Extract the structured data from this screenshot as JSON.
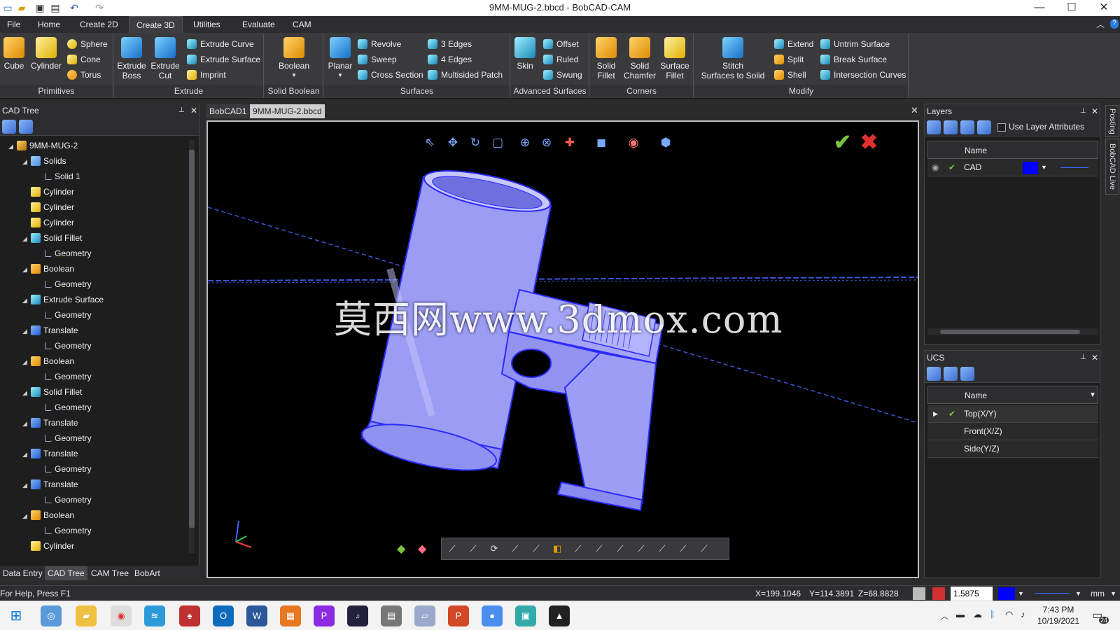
{
  "window": {
    "title": "9MM-MUG-2.bbcd - BobCAD-CAM",
    "minimize": "—",
    "maximize": "☐",
    "close": "✕"
  },
  "quick_access": [
    "new-doc-icon",
    "open-folder-icon",
    "save-icon",
    "save-all-icon",
    "undo-icon",
    "redo-icon"
  ],
  "menus": [
    "File",
    "Home",
    "Create 2D",
    "Create 3D",
    "Utilities",
    "Evaluate",
    "CAM"
  ],
  "active_menu": "Create 3D",
  "ribbon": {
    "primitives": {
      "label": "Primitives",
      "cube": "Cube",
      "cylinder": "Cylinder",
      "sphere": "Sphere",
      "cone": "Cone",
      "torus": "Torus"
    },
    "extrude": {
      "label": "Extrude",
      "boss": "Extrude\nBoss",
      "cut": "Extrude\nCut",
      "curve": "Extrude Curve",
      "surface": "Extrude Surface",
      "imprint": "Imprint"
    },
    "solid_boolean": {
      "label": "Solid Boolean",
      "boolean": "Boolean"
    },
    "surfaces": {
      "label": "Surfaces",
      "planar": "Planar",
      "revolve": "Revolve",
      "sweep": "Sweep",
      "cross_section": "Cross Section",
      "edges3": "3 Edges",
      "edges4": "4 Edges",
      "multisided": "Multisided Patch"
    },
    "advanced": {
      "label": "Advanced Surfaces",
      "skin": "Skin",
      "offset": "Offset",
      "ruled": "Ruled",
      "swung": "Swung"
    },
    "corners": {
      "label": "Corners",
      "solid_fillet": "Solid\nFillet",
      "solid_chamfer": "Solid\nChamfer",
      "surface_fillet": "Surface\nFillet"
    },
    "modify": {
      "label": "Modify",
      "stitch": "Stitch\nSurfaces to Solid",
      "extend": "Extend",
      "split": "Split",
      "shell": "Shell",
      "untrim": "Untrim Surface",
      "break": "Break Surface",
      "intersection": "Intersection Curves"
    }
  },
  "cad_tree": {
    "title": "CAD Tree",
    "items": [
      {
        "label": "9MM-MUG-2",
        "level": 0,
        "expand": "◢",
        "icon": "gear"
      },
      {
        "label": "Solids",
        "level": 1,
        "expand": "◢",
        "icon": "folder"
      },
      {
        "label": "Solid 1",
        "level": 2,
        "expand": "",
        "icon": "solid"
      },
      {
        "label": "Cylinder",
        "level": 1,
        "expand": "",
        "icon": "yellow"
      },
      {
        "label": "Cylinder",
        "level": 1,
        "expand": "",
        "icon": "yellow"
      },
      {
        "label": "Cylinder",
        "level": 1,
        "expand": "",
        "icon": "yellow"
      },
      {
        "label": "Solid Fillet",
        "level": 1,
        "expand": "◢",
        "icon": "teal"
      },
      {
        "label": "Geometry",
        "level": 2,
        "expand": "",
        "icon": "geo"
      },
      {
        "label": "Boolean",
        "level": 1,
        "expand": "◢",
        "icon": "orange"
      },
      {
        "label": "Geometry",
        "level": 2,
        "expand": "",
        "icon": "geo"
      },
      {
        "label": "Extrude Surface",
        "level": 1,
        "expand": "◢",
        "icon": "teal"
      },
      {
        "label": "Geometry",
        "level": 2,
        "expand": "",
        "icon": "geo"
      },
      {
        "label": "Translate",
        "level": 1,
        "expand": "◢",
        "icon": "blue"
      },
      {
        "label": "Geometry",
        "level": 2,
        "expand": "",
        "icon": "geo"
      },
      {
        "label": "Boolean",
        "level": 1,
        "expand": "◢",
        "icon": "orange"
      },
      {
        "label": "Geometry",
        "level": 2,
        "expand": "",
        "icon": "geo"
      },
      {
        "label": "Solid Fillet",
        "level": 1,
        "expand": "◢",
        "icon": "teal"
      },
      {
        "label": "Geometry",
        "level": 2,
        "expand": "",
        "icon": "geo"
      },
      {
        "label": "Translate",
        "level": 1,
        "expand": "◢",
        "icon": "blue"
      },
      {
        "label": "Geometry",
        "level": 2,
        "expand": "",
        "icon": "geo"
      },
      {
        "label": "Translate",
        "level": 1,
        "expand": "◢",
        "icon": "blue"
      },
      {
        "label": "Geometry",
        "level": 2,
        "expand": "",
        "icon": "geo"
      },
      {
        "label": "Translate",
        "level": 1,
        "expand": "◢",
        "icon": "blue"
      },
      {
        "label": "Geometry",
        "level": 2,
        "expand": "",
        "icon": "geo"
      },
      {
        "label": "Boolean",
        "level": 1,
        "expand": "◢",
        "icon": "orange"
      },
      {
        "label": "Geometry",
        "level": 2,
        "expand": "",
        "icon": "geo"
      },
      {
        "label": "Cylinder",
        "level": 1,
        "expand": "",
        "icon": "yellow"
      }
    ]
  },
  "bottom_tabs": [
    "Data Entry",
    "CAD Tree",
    "CAM Tree",
    "BobArt"
  ],
  "doc_tabs": [
    "BobCAD1",
    "9MM-MUG-2.bbcd"
  ],
  "viewport": {
    "watermark": "莫西网www.3dmox.com"
  },
  "layers": {
    "title": "Layers",
    "use_layer_attributes": "Use Layer Attributes",
    "col_name": "Name",
    "rows": [
      {
        "name": "CAD",
        "color": "#0000ff"
      }
    ]
  },
  "ucs": {
    "title": "UCS",
    "col_name": "Name",
    "rows": [
      "Top(X/Y)",
      "Front(X/Z)",
      "Side(Y/Z)"
    ]
  },
  "side_tabs": [
    "Posting",
    "BobCAD Live"
  ],
  "status": {
    "help": "For Help, Press F1",
    "x": "X=199.1046",
    "y": "Y=114.3891",
    "z": "Z=68.8828",
    "value": "1.5875",
    "unit": "mm"
  },
  "taskbar": {
    "time": "7:43 PM",
    "date": "10/19/2021",
    "badge": "24"
  }
}
